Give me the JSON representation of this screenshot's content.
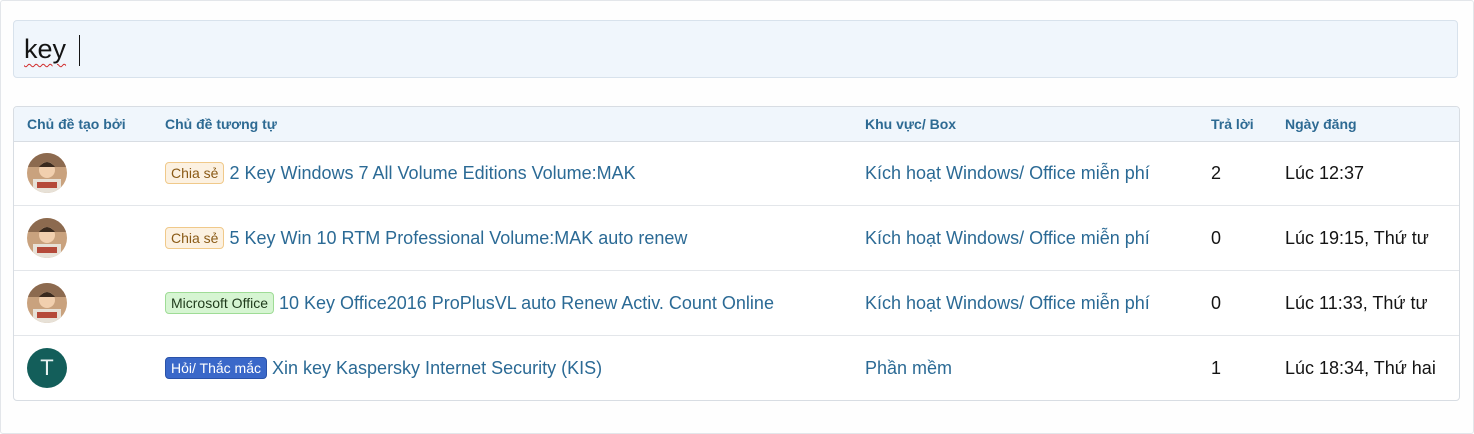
{
  "search": {
    "value": "key"
  },
  "table": {
    "headers": {
      "author": "Chủ đề tạo bởi",
      "thread": "Chủ đề tương tự",
      "forum": "Khu vực/ Box",
      "replies": "Trả lời",
      "date": "Ngày đăng"
    },
    "rows": [
      {
        "avatar": "photo-avatar",
        "prefix": "Chia sẻ",
        "prefix_style": "share",
        "title": "2 Key Windows 7 All Volume Editions Volume:MAK",
        "forum": "Kích hoạt Windows/ Office miễn phí",
        "replies": "2",
        "date": "Lúc 12:37"
      },
      {
        "avatar": "photo-avatar",
        "prefix": "Chia sẻ",
        "prefix_style": "share",
        "title": "5 Key Win 10 RTM Professional Volume:MAK auto renew",
        "forum": "Kích hoạt Windows/ Office miễn phí",
        "replies": "0",
        "date": "Lúc 19:15, Thứ tư"
      },
      {
        "avatar": "photo-avatar",
        "prefix": "Microsoft Office",
        "prefix_style": "msoffice",
        "title": "10 Key Office2016 ProPlusVL auto Renew Activ. Count Online",
        "forum": "Kích hoạt Windows/ Office miễn phí",
        "replies": "0",
        "date": "Lúc 11:33, Thứ tư"
      },
      {
        "avatar_letter": "T",
        "avatar_color": "#135e5a",
        "prefix": "Hỏi/ Thắc mắc",
        "prefix_style": "question",
        "title": "Xin key Kaspersky Internet Security (KIS)",
        "forum": "Phần mềm",
        "replies": "1",
        "date": "Lúc 18:34, Thứ hai"
      }
    ]
  },
  "colors": {
    "link": "#2b6a95",
    "header_text": "#2d6a93",
    "header_bg": "#f0f6fc",
    "prefix_share_bg": "#fcf1e1",
    "prefix_msoffice_bg": "#d6f5d2",
    "prefix_question_bg": "#3a68c9"
  }
}
